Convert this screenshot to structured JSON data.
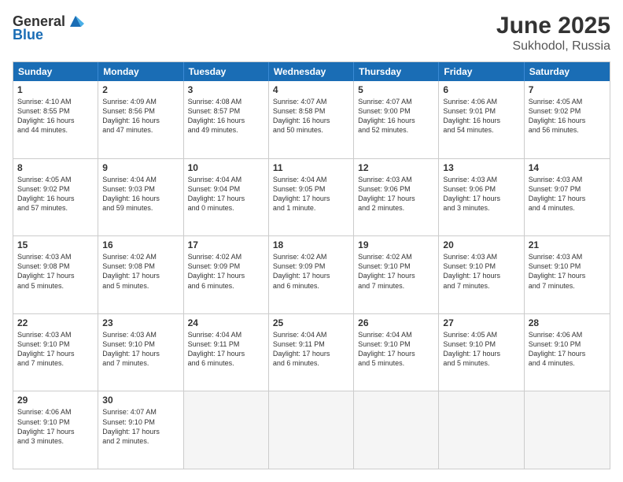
{
  "header": {
    "logo_general": "General",
    "logo_blue": "Blue",
    "month": "June 2025",
    "location": "Sukhodol, Russia"
  },
  "weekdays": [
    "Sunday",
    "Monday",
    "Tuesday",
    "Wednesday",
    "Thursday",
    "Friday",
    "Saturday"
  ],
  "rows": [
    [
      {
        "day": "1",
        "lines": [
          "Sunrise: 4:10 AM",
          "Sunset: 8:55 PM",
          "Daylight: 16 hours",
          "and 44 minutes."
        ]
      },
      {
        "day": "2",
        "lines": [
          "Sunrise: 4:09 AM",
          "Sunset: 8:56 PM",
          "Daylight: 16 hours",
          "and 47 minutes."
        ]
      },
      {
        "day": "3",
        "lines": [
          "Sunrise: 4:08 AM",
          "Sunset: 8:57 PM",
          "Daylight: 16 hours",
          "and 49 minutes."
        ]
      },
      {
        "day": "4",
        "lines": [
          "Sunrise: 4:07 AM",
          "Sunset: 8:58 PM",
          "Daylight: 16 hours",
          "and 50 minutes."
        ]
      },
      {
        "day": "5",
        "lines": [
          "Sunrise: 4:07 AM",
          "Sunset: 9:00 PM",
          "Daylight: 16 hours",
          "and 52 minutes."
        ]
      },
      {
        "day": "6",
        "lines": [
          "Sunrise: 4:06 AM",
          "Sunset: 9:01 PM",
          "Daylight: 16 hours",
          "and 54 minutes."
        ]
      },
      {
        "day": "7",
        "lines": [
          "Sunrise: 4:05 AM",
          "Sunset: 9:02 PM",
          "Daylight: 16 hours",
          "and 56 minutes."
        ]
      }
    ],
    [
      {
        "day": "8",
        "lines": [
          "Sunrise: 4:05 AM",
          "Sunset: 9:02 PM",
          "Daylight: 16 hours",
          "and 57 minutes."
        ]
      },
      {
        "day": "9",
        "lines": [
          "Sunrise: 4:04 AM",
          "Sunset: 9:03 PM",
          "Daylight: 16 hours",
          "and 59 minutes."
        ]
      },
      {
        "day": "10",
        "lines": [
          "Sunrise: 4:04 AM",
          "Sunset: 9:04 PM",
          "Daylight: 17 hours",
          "and 0 minutes."
        ]
      },
      {
        "day": "11",
        "lines": [
          "Sunrise: 4:04 AM",
          "Sunset: 9:05 PM",
          "Daylight: 17 hours",
          "and 1 minute."
        ]
      },
      {
        "day": "12",
        "lines": [
          "Sunrise: 4:03 AM",
          "Sunset: 9:06 PM",
          "Daylight: 17 hours",
          "and 2 minutes."
        ]
      },
      {
        "day": "13",
        "lines": [
          "Sunrise: 4:03 AM",
          "Sunset: 9:06 PM",
          "Daylight: 17 hours",
          "and 3 minutes."
        ]
      },
      {
        "day": "14",
        "lines": [
          "Sunrise: 4:03 AM",
          "Sunset: 9:07 PM",
          "Daylight: 17 hours",
          "and 4 minutes."
        ]
      }
    ],
    [
      {
        "day": "15",
        "lines": [
          "Sunrise: 4:03 AM",
          "Sunset: 9:08 PM",
          "Daylight: 17 hours",
          "and 5 minutes."
        ]
      },
      {
        "day": "16",
        "lines": [
          "Sunrise: 4:02 AM",
          "Sunset: 9:08 PM",
          "Daylight: 17 hours",
          "and 5 minutes."
        ]
      },
      {
        "day": "17",
        "lines": [
          "Sunrise: 4:02 AM",
          "Sunset: 9:09 PM",
          "Daylight: 17 hours",
          "and 6 minutes."
        ]
      },
      {
        "day": "18",
        "lines": [
          "Sunrise: 4:02 AM",
          "Sunset: 9:09 PM",
          "Daylight: 17 hours",
          "and 6 minutes."
        ]
      },
      {
        "day": "19",
        "lines": [
          "Sunrise: 4:02 AM",
          "Sunset: 9:10 PM",
          "Daylight: 17 hours",
          "and 7 minutes."
        ]
      },
      {
        "day": "20",
        "lines": [
          "Sunrise: 4:03 AM",
          "Sunset: 9:10 PM",
          "Daylight: 17 hours",
          "and 7 minutes."
        ]
      },
      {
        "day": "21",
        "lines": [
          "Sunrise: 4:03 AM",
          "Sunset: 9:10 PM",
          "Daylight: 17 hours",
          "and 7 minutes."
        ]
      }
    ],
    [
      {
        "day": "22",
        "lines": [
          "Sunrise: 4:03 AM",
          "Sunset: 9:10 PM",
          "Daylight: 17 hours",
          "and 7 minutes."
        ]
      },
      {
        "day": "23",
        "lines": [
          "Sunrise: 4:03 AM",
          "Sunset: 9:10 PM",
          "Daylight: 17 hours",
          "and 7 minutes."
        ]
      },
      {
        "day": "24",
        "lines": [
          "Sunrise: 4:04 AM",
          "Sunset: 9:11 PM",
          "Daylight: 17 hours",
          "and 6 minutes."
        ]
      },
      {
        "day": "25",
        "lines": [
          "Sunrise: 4:04 AM",
          "Sunset: 9:11 PM",
          "Daylight: 17 hours",
          "and 6 minutes."
        ]
      },
      {
        "day": "26",
        "lines": [
          "Sunrise: 4:04 AM",
          "Sunset: 9:10 PM",
          "Daylight: 17 hours",
          "and 5 minutes."
        ]
      },
      {
        "day": "27",
        "lines": [
          "Sunrise: 4:05 AM",
          "Sunset: 9:10 PM",
          "Daylight: 17 hours",
          "and 5 minutes."
        ]
      },
      {
        "day": "28",
        "lines": [
          "Sunrise: 4:06 AM",
          "Sunset: 9:10 PM",
          "Daylight: 17 hours",
          "and 4 minutes."
        ]
      }
    ],
    [
      {
        "day": "29",
        "lines": [
          "Sunrise: 4:06 AM",
          "Sunset: 9:10 PM",
          "Daylight: 17 hours",
          "and 3 minutes."
        ]
      },
      {
        "day": "30",
        "lines": [
          "Sunrise: 4:07 AM",
          "Sunset: 9:10 PM",
          "Daylight: 17 hours",
          "and 2 minutes."
        ]
      },
      {
        "day": "",
        "lines": []
      },
      {
        "day": "",
        "lines": []
      },
      {
        "day": "",
        "lines": []
      },
      {
        "day": "",
        "lines": []
      },
      {
        "day": "",
        "lines": []
      }
    ]
  ]
}
